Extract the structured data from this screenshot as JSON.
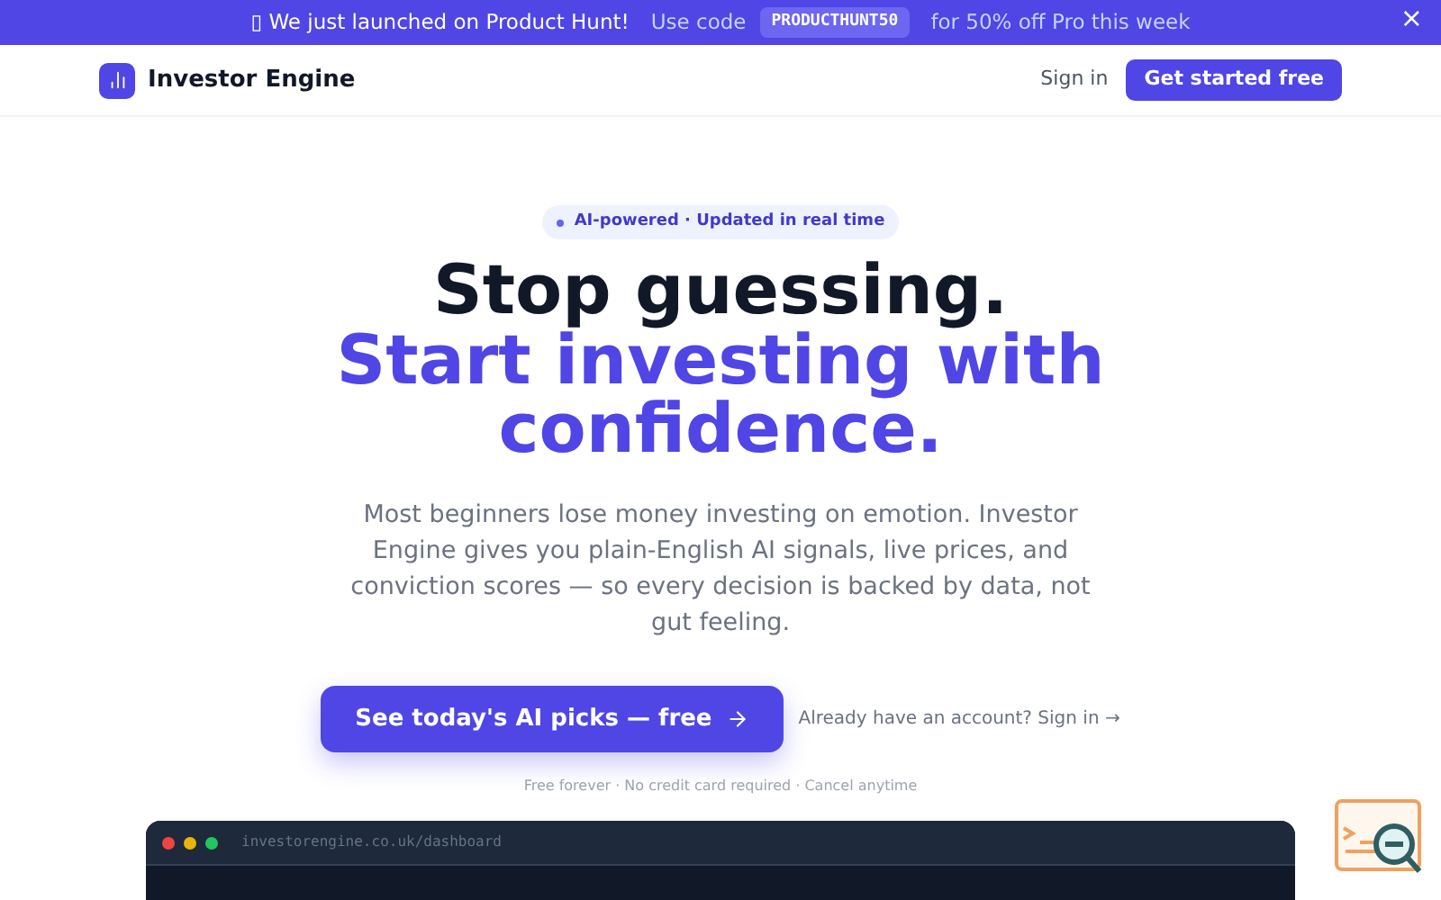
{
  "banner": {
    "announcement": "▯ We just launched on Product Hunt!",
    "code_prefix": "Use code",
    "code": "PRODUCTHUNT50",
    "offer": "for 50% off Pro this week",
    "close": "×"
  },
  "nav": {
    "brand": "Investor Engine",
    "sign_in": "Sign in",
    "cta": "Get started free"
  },
  "hero": {
    "badge": "AI-powered · Updated in real time",
    "headline": "Stop guessing.",
    "headline_accent": "Start investing with confidence.",
    "description": "Most beginners lose money investing on emotion. Investor Engine gives you plain-English AI signals, live prices, and conviction scores — so every decision is backed by data, not gut feeling.",
    "primary_button": "See today's AI picks — free",
    "secondary_link": "Already have an account? Sign in →",
    "footnote": "Free forever · No credit card required · Cancel anytime"
  },
  "preview": {
    "url": "investorengine.co.uk/dashboard",
    "dots": [
      {
        "color": "#ef4444"
      },
      {
        "color": "#eab308"
      },
      {
        "color": "#22c55e"
      }
    ]
  }
}
